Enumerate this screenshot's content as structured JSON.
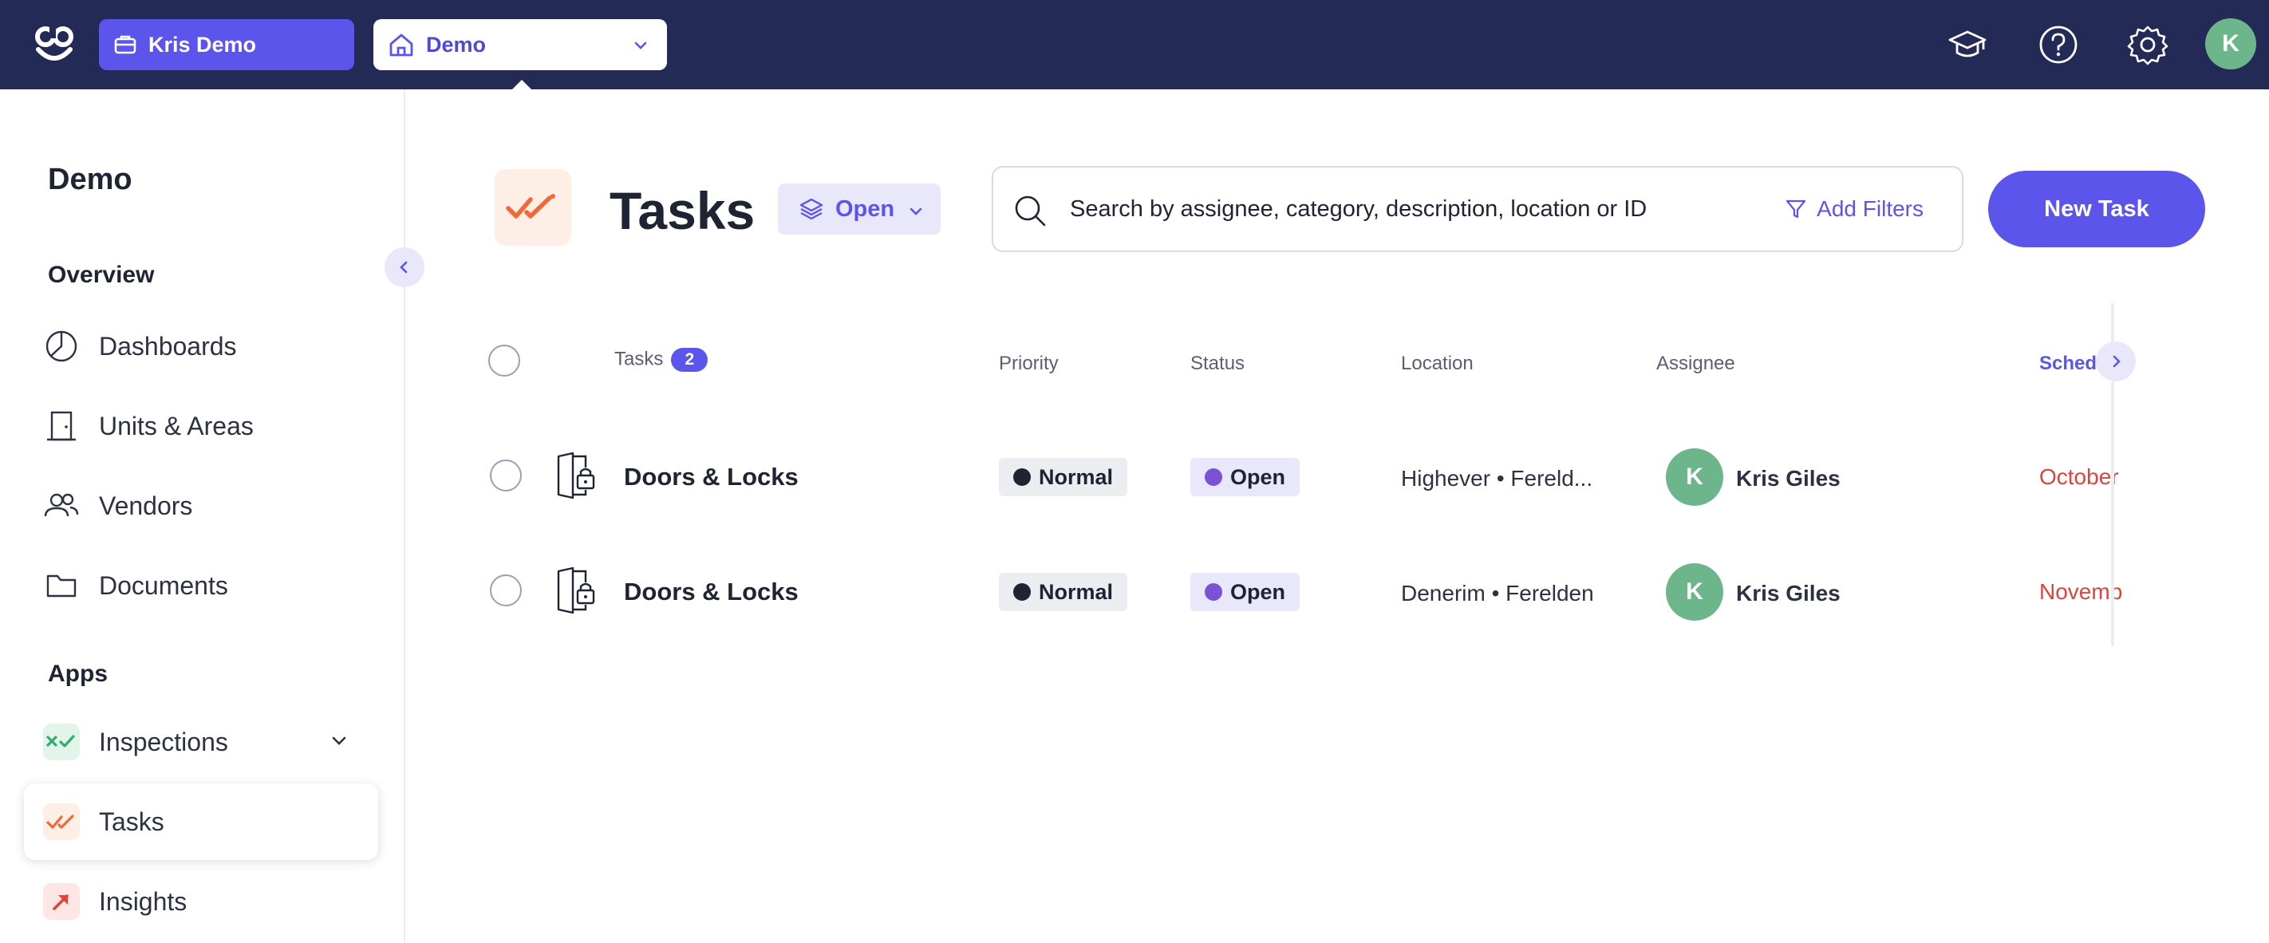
{
  "topbar": {
    "org_label": "Kris Demo",
    "site_label": "Demo",
    "user_initial": "K",
    "icons": [
      "logo-icon",
      "graduation-cap-icon",
      "help-icon",
      "settings-icon"
    ]
  },
  "sidebar": {
    "title": "Demo",
    "overview_heading": "Overview",
    "overview_items": [
      {
        "label": "Dashboards",
        "icon": "dashboards-icon"
      },
      {
        "label": "Units & Areas",
        "icon": "door-icon"
      },
      {
        "label": "Vendors",
        "icon": "users-icon"
      },
      {
        "label": "Documents",
        "icon": "folder-icon"
      }
    ],
    "apps_heading": "Apps",
    "app_items": [
      {
        "label": "Inspections",
        "icon": "inspections-icon",
        "color": "#2fae6b"
      },
      {
        "label": "Tasks",
        "icon": "tasks-icon",
        "color": "#ef6a3a",
        "active": true
      },
      {
        "label": "Insights",
        "icon": "insights-icon",
        "color": "#e0453b"
      }
    ]
  },
  "main": {
    "title": "Tasks",
    "status_filter": "Open",
    "search_placeholder": "Search by assignee, category, description, location or ID",
    "add_filters": "Add Filters",
    "new_task": "New Task"
  },
  "table": {
    "headers": {
      "tasks": "Tasks",
      "count": "2",
      "priority": "Priority",
      "status": "Status",
      "location": "Location",
      "assignee": "Assignee",
      "scheduled": "Schedu"
    },
    "rows": [
      {
        "title": "Doors & Locks",
        "priority": "Normal",
        "status": "Open",
        "location": "Highever • Fereld...",
        "assignee_initial": "K",
        "assignee": "Kris Giles",
        "scheduled": "October"
      },
      {
        "title": "Doors & Locks",
        "priority": "Normal",
        "status": "Open",
        "location": "Denerim • Ferelden",
        "assignee_initial": "K",
        "assignee": "Kris Giles",
        "scheduled": "Novemb"
      }
    ]
  },
  "colors": {
    "topbar": "#242a56",
    "accent": "#5b55ec",
    "status_open_dot": "#7a52d6",
    "priority_dot": "#1f2433",
    "overdue": "#d9463b",
    "avatar": "#6db58a"
  }
}
